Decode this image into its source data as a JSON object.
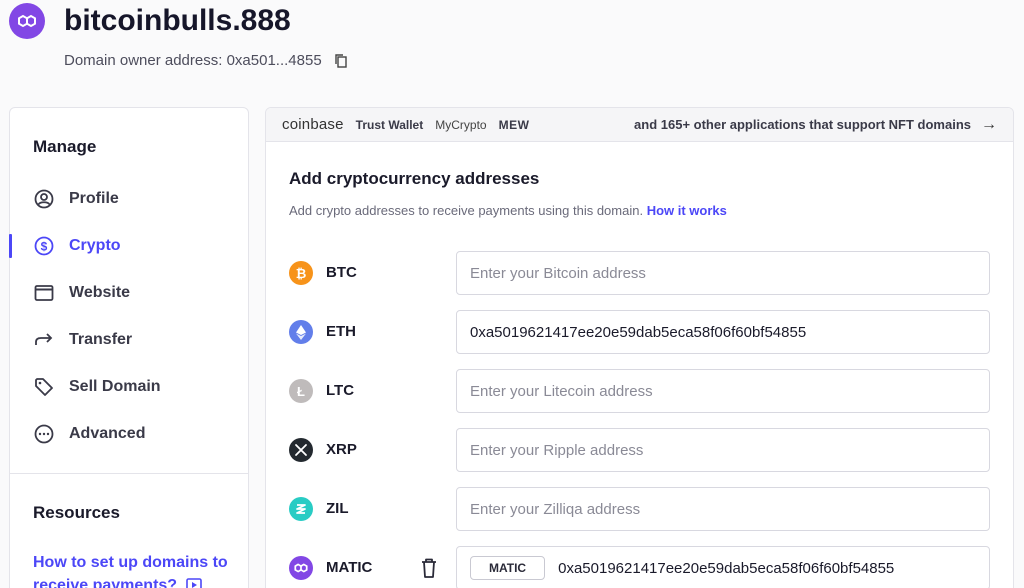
{
  "header": {
    "domain": "bitcoinbulls.888",
    "owner_label": "Domain owner address: 0xa501...4855"
  },
  "sidebar": {
    "manage_heading": "Manage",
    "items": [
      {
        "label": "Profile",
        "icon": "user-circle-icon"
      },
      {
        "label": "Crypto",
        "icon": "dollar-circle-icon",
        "active": true
      },
      {
        "label": "Website",
        "icon": "browser-window-icon"
      },
      {
        "label": "Transfer",
        "icon": "forward-arrow-icon"
      },
      {
        "label": "Sell Domain",
        "icon": "tag-icon"
      },
      {
        "label": "Advanced",
        "icon": "more-horizontal-icon"
      }
    ],
    "resources_heading": "Resources",
    "resource_link": "How to set up domains to receive payments?"
  },
  "banner": {
    "brands": [
      "coinbase",
      "Trust Wallet",
      "MyCrypto",
      "MEW"
    ],
    "more_text": "and 165+ other applications that support NFT domains"
  },
  "crypto": {
    "title": "Add cryptocurrency addresses",
    "subtitle": "Add crypto addresses to receive payments using this domain.",
    "how_link": "How it works",
    "coins": [
      {
        "symbol": "BTC",
        "placeholder": "Enter your Bitcoin address",
        "value": "",
        "color": "#f7931a"
      },
      {
        "symbol": "ETH",
        "placeholder": "",
        "value": "0xa5019621417ee20e59dab5eca58f06f60bf54855",
        "color": "#627eea"
      },
      {
        "symbol": "LTC",
        "placeholder": "Enter your Litecoin address",
        "value": "",
        "color": "#bfbbbb"
      },
      {
        "symbol": "XRP",
        "placeholder": "Enter your Ripple address",
        "value": "",
        "color": "#23292f"
      },
      {
        "symbol": "ZIL",
        "placeholder": "Enter your Zilliqa address",
        "value": "",
        "color": "#29ccc4"
      },
      {
        "symbol": "MATIC",
        "tag": "MATIC",
        "value": "0xa5019621417ee20e59dab5eca58f06f60bf54855",
        "color": "#8247e5"
      }
    ]
  },
  "colors": {
    "accent": "#4c47f7",
    "polygon_purple": "#8247e5"
  }
}
